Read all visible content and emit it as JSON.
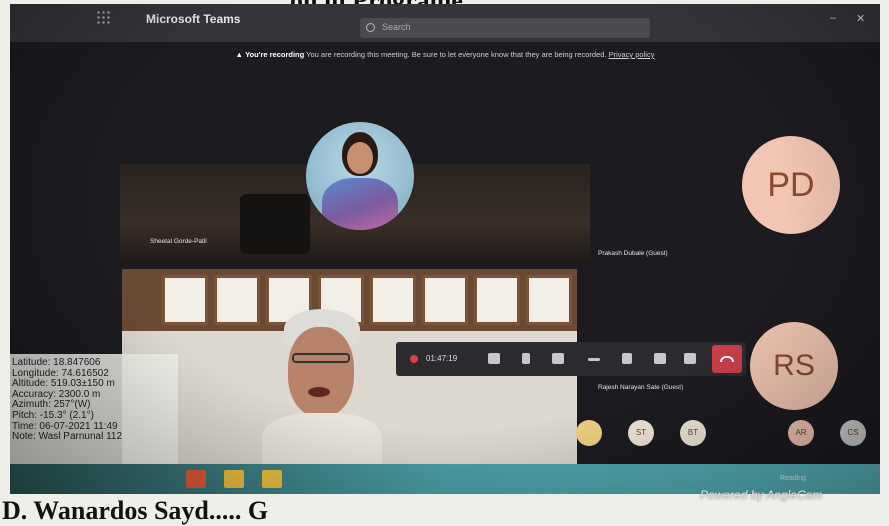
{
  "document": {
    "heading_fragment": "on in Programe",
    "caption_fragment": "D. Wanardos Sayd..... G"
  },
  "teams": {
    "app_title": "Microsoft Teams",
    "search_placeholder": "Search",
    "recording_banner": {
      "title": "You're recording",
      "message": "You are recording this meeting. Be sure to let everyone know that they are being recorded.",
      "link": "Privacy policy"
    },
    "participants": [
      {
        "name": "Sheetal Gorde-Patil",
        "display": "photo"
      },
      {
        "name": "Prakash Dubale (Guest)",
        "initials": "PD"
      },
      {
        "name": "Rajesh Narayan Sate (Guest)",
        "initials": "RS"
      }
    ],
    "meeting_timer": "01:47:19",
    "small_avatars": [
      "ST",
      "BT",
      "AR",
      "CS"
    ],
    "taskbar_clock": "Reading"
  },
  "geotag": {
    "lines": [
      "Latitude: 18.847606",
      "Longitude: 74.616502",
      "Altitude: 519.03±150 m",
      "Accuracy: 2300.0 m",
      "Azimuth: 257°(W)",
      "Pitch: -15.3° (2.1°)",
      "Time: 06-07-2021 11:49",
      "Note: Wasl Parnunal 112"
    ]
  },
  "watermark": "Powered by AngleCam"
}
